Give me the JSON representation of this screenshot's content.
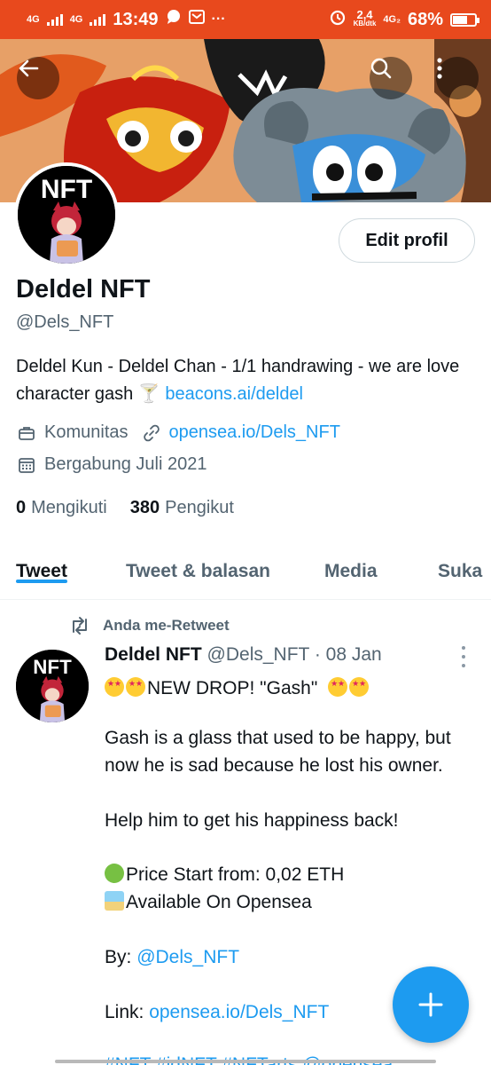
{
  "status_bar": {
    "network_1": "4G",
    "network_2": "4G",
    "time": "13:49",
    "more": "···",
    "speed": "2,4",
    "speed_unit": "KB/dtk",
    "network_3": "4G₂",
    "battery": "68%",
    "battery_level": 0.68
  },
  "colors": {
    "accent": "#1d9bf0",
    "status_bar": "#e8491d",
    "text_primary": "#0f1419",
    "text_secondary": "#536471"
  },
  "header": {
    "back_icon": "arrow-left-icon",
    "search_icon": "search-icon",
    "more_icon": "more-vertical-icon"
  },
  "profile": {
    "avatar_text": "NFT",
    "edit_button": "Edit profil",
    "name": "Deldel NFT",
    "handle": "@Dels_NFT",
    "bio_text": "Deldel Kun - Deldel Chan - 1/1 handrawing - we are love character gash",
    "bio_emoji": "🍸",
    "bio_link": "beacons.ai/deldel",
    "category": "Komunitas",
    "website": "opensea.io/Dels_NFT",
    "joined": "Bergabung Juli 2021",
    "following_count": "0",
    "following_label": "Mengikuti",
    "followers_count": "380",
    "followers_label": "Pengikut"
  },
  "tabs": [
    {
      "label": "Tweet",
      "active": true
    },
    {
      "label": "Tweet & balasan",
      "active": false
    },
    {
      "label": "Media",
      "active": false
    },
    {
      "label": "Suka",
      "active": false
    }
  ],
  "tweet": {
    "retweet_label": "Anda me-Retweet",
    "avatar_text": "NFT",
    "author_name": "Deldel NFT",
    "author_handle": "@Dels_NFT",
    "separator": "·",
    "date": "08 Jan",
    "line_1": "NEW DROP! \"Gash\"",
    "line_2": "Gash is a glass that used to be happy, but now he is sad because he lost his owner.",
    "line_3": "Help him to get his happiness back!",
    "price": "Price Start from: 0,02 ETH",
    "available": "Available On Opensea",
    "by_label": "By:",
    "by_handle": "@Dels_NFT",
    "link_label": "Link:",
    "link_url": "opensea.io/Dels_NFT",
    "hashtags_cut": "#NFT #idNFT #NFTarts @opensea"
  },
  "fab": {
    "icon": "plus-icon"
  }
}
